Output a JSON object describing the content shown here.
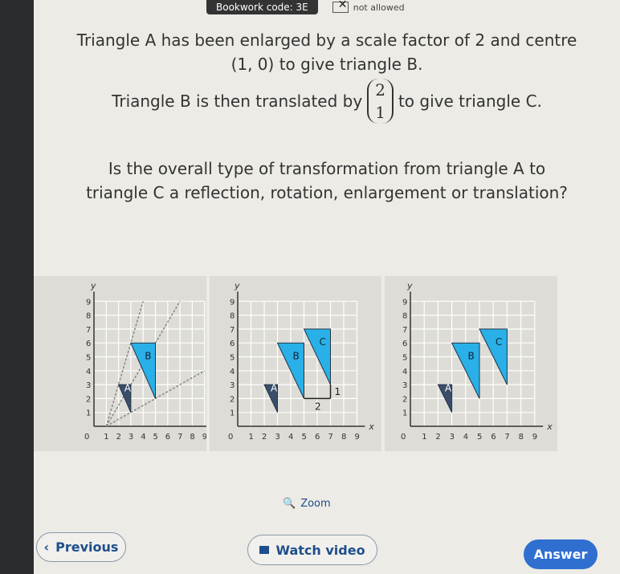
{
  "header": {
    "bookwork_code": "Bookwork code: 3E",
    "calculator": "not allowed"
  },
  "question": {
    "line1": "Triangle A has been enlarged by a scale factor of 2 and centre (1, 0) to give triangle B.",
    "line2_before": "Triangle B is then translated by",
    "vector_top": "2",
    "vector_bottom": "1",
    "line2_after": "to give triangle C.",
    "line3": "Is the overall type of transformation from triangle A to triangle C a reflection, rotation, enlargement or translation?"
  },
  "graphs": [
    {
      "triangles": [
        {
          "label": "A",
          "points": [
            [
              2,
              3
            ],
            [
              3,
              3
            ],
            [
              3,
              1
            ]
          ],
          "color": "#3a4d6a"
        },
        {
          "label": "B",
          "points": [
            [
              3,
              6
            ],
            [
              5,
              6
            ],
            [
              5,
              2
            ]
          ],
          "color": "#2ab0e8"
        }
      ],
      "rays": true,
      "arrows": false
    },
    {
      "triangles": [
        {
          "label": "A",
          "points": [
            [
              2,
              3
            ],
            [
              3,
              3
            ],
            [
              3,
              1
            ]
          ],
          "color": "#3a4d6a"
        },
        {
          "label": "B",
          "points": [
            [
              3,
              6
            ],
            [
              5,
              6
            ],
            [
              5,
              2
            ]
          ],
          "color": "#2ab0e8"
        },
        {
          "label": "C",
          "points": [
            [
              5,
              7
            ],
            [
              7,
              7
            ],
            [
              7,
              3
            ]
          ],
          "color": "#2ab0e8"
        }
      ],
      "rays": false,
      "arrows": true,
      "arrow_labels": [
        "2",
        "1"
      ]
    },
    {
      "triangles": [
        {
          "label": "A",
          "points": [
            [
              2,
              3
            ],
            [
              3,
              3
            ],
            [
              3,
              1
            ]
          ],
          "color": "#3a4d6a"
        },
        {
          "label": "B",
          "points": [
            [
              3,
              6
            ],
            [
              5,
              6
            ],
            [
              5,
              2
            ]
          ],
          "color": "#2ab0e8"
        },
        {
          "label": "C",
          "points": [
            [
              5,
              7
            ],
            [
              7,
              7
            ],
            [
              7,
              3
            ]
          ],
          "color": "#2ab0e8"
        }
      ],
      "rays": false,
      "arrows": false
    }
  ],
  "axis": {
    "x_label": "x",
    "y_label": "y",
    "x_ticks": [
      "0",
      "1",
      "2",
      "3",
      "4",
      "5",
      "6",
      "7",
      "8",
      "9"
    ],
    "y_ticks": [
      "1",
      "2",
      "3",
      "4",
      "5",
      "6",
      "7",
      "8",
      "9"
    ]
  },
  "zoom_label": "Zoom",
  "buttons": {
    "previous": "Previous",
    "watch_video": "Watch video",
    "answer": "Answer"
  }
}
